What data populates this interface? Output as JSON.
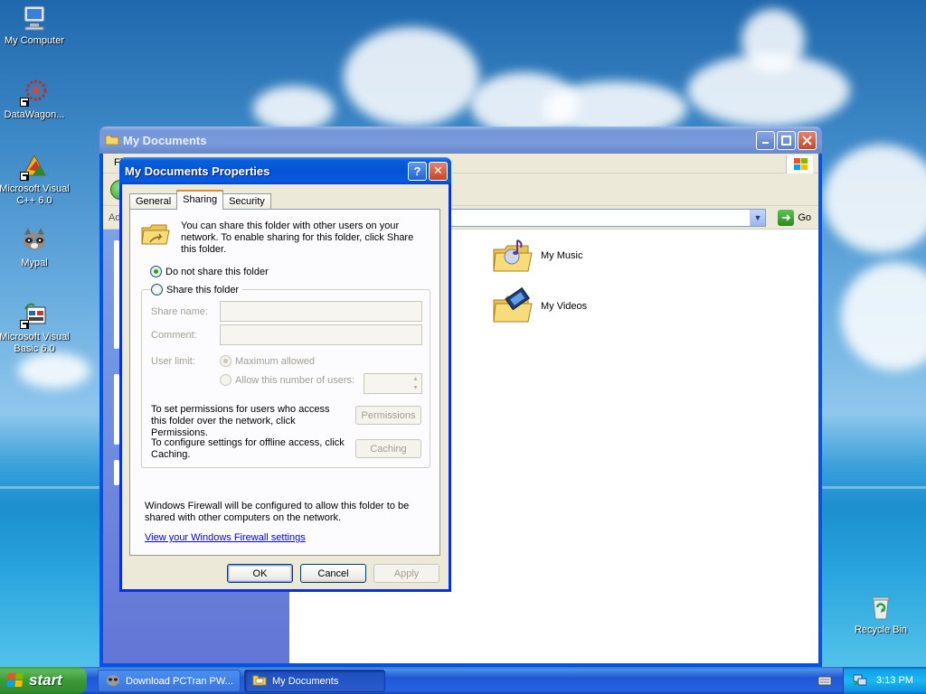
{
  "desktop": {
    "icons": [
      {
        "label": "My Computer"
      },
      {
        "label": "DataWagon..."
      },
      {
        "label": "Microsoft Visual C++ 6.0"
      },
      {
        "label": "Mypal"
      },
      {
        "label": "Microsoft Visual Basic 6.0"
      },
      {
        "label": "Recycle Bin"
      }
    ]
  },
  "explorer": {
    "title": "My Documents",
    "menu_first": "Fi",
    "address_label": "Ad",
    "go_label": "Go",
    "items": [
      {
        "label": "My Music",
        "icon": "music-folder-icon"
      },
      {
        "label": "My Videos",
        "icon": "video-folder-icon"
      }
    ]
  },
  "dialog": {
    "title": "My Documents Properties",
    "help_symbol": "?",
    "close_symbol": "✕",
    "tabs": [
      {
        "label": "General",
        "active": false
      },
      {
        "label": "Sharing",
        "active": true
      },
      {
        "label": "Security",
        "active": false
      }
    ],
    "info_text": "You can share this folder with other users on your network.  To enable sharing for this folder, click Share this folder.",
    "radio_no_share": {
      "label": "Do not share this folder",
      "checked": true
    },
    "radio_share": {
      "label": "Share this folder",
      "checked": false
    },
    "share_name": {
      "label": "Share name:",
      "value": ""
    },
    "comment": {
      "label": "Comment:",
      "value": ""
    },
    "user_limit": {
      "label": "User limit:",
      "max_allowed": {
        "label": "Maximum allowed",
        "checked": true
      },
      "allow_number": {
        "label": "Allow this number of users:",
        "checked": false,
        "value": ""
      }
    },
    "permissions_text": "To set permissions for users who access this folder over the network, click Permissions.",
    "permissions_button": "Permissions",
    "caching_text": "To configure settings for offline access, click Caching.",
    "caching_button": "Caching",
    "firewall_text": "Windows Firewall will be configured to allow this folder to be shared with other computers on the network.",
    "firewall_link": "View your Windows Firewall settings",
    "buttons": {
      "ok": "OK",
      "cancel": "Cancel",
      "apply": "Apply"
    }
  },
  "taskbar": {
    "start_label": "start",
    "tasks": [
      {
        "label": "Download PCTran PW...",
        "active": false
      },
      {
        "label": "My Documents",
        "active": true
      }
    ],
    "clock": "3:13 PM"
  },
  "colors": {
    "xp_blue": "#0054e3",
    "dialog_title_blue": "#0453d6",
    "start_green": "#3a9b37",
    "link_blue": "#0000ff",
    "disabled_text": "#a19f92"
  }
}
